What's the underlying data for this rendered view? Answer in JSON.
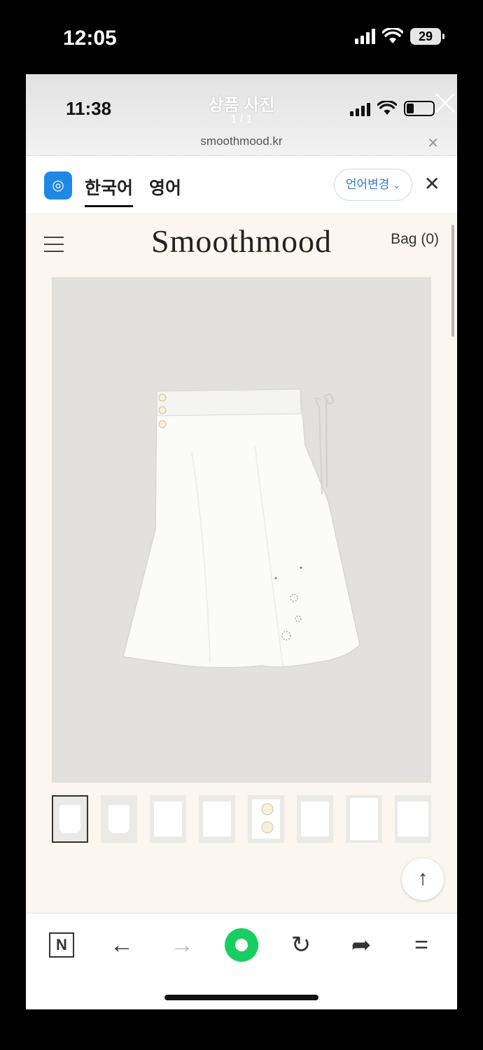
{
  "outer_status": {
    "time": "12:05",
    "battery": "29"
  },
  "viewer": {
    "inner_time": "11:38",
    "title": "상품 사진",
    "count": "1 / 1",
    "url": "smoothmood.kr"
  },
  "translate": {
    "tab_korean": "한국어",
    "tab_english": "영어",
    "change_language": "언어변경"
  },
  "site": {
    "logo": "Smoothmood",
    "bag": "Bag (0)"
  },
  "product": {
    "thumbnails": [
      "front",
      "back",
      "waist-tie",
      "embroidery",
      "buttons",
      "side-tie",
      "detail",
      "label"
    ],
    "selected_thumbnail": 0
  },
  "accent_colors": {
    "browser_green": "#19ce60",
    "translate_blue": "#1e88e5"
  }
}
